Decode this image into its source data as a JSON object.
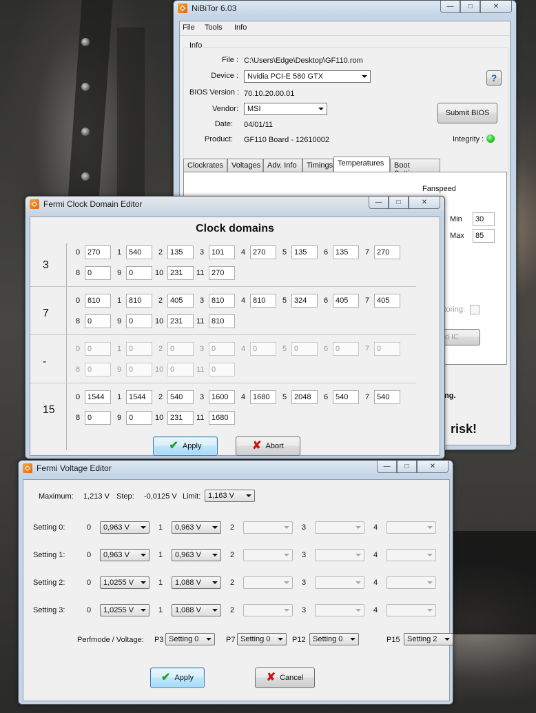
{
  "nibitor": {
    "title": "NiBiTor 6.03",
    "menu": [
      "File",
      "Tools",
      "Info"
    ],
    "info_label": "Info",
    "file_label": "File :",
    "file_value": "C:\\Users\\Edge\\Desktop\\GF110.rom",
    "device_label": "Device :",
    "device_value": "Nvidia PCI-E 580 GTX",
    "bios_label": "BIOS Version :",
    "bios_value": "70.10.20.00.01",
    "vendor_label": "Vendor:",
    "vendor_value": "MSI",
    "date_label": "Date:",
    "date_value": "04/01/11",
    "product_label": "Product:",
    "product_value": "GF110 Board - 12610002",
    "help_label": "?",
    "submit_label": "Submit BIOS",
    "integrity_label": "Integrity :",
    "integrity_color": "#22c022",
    "tabs": [
      "Clockrates",
      "Voltages",
      "Adv. Info",
      "Timings",
      "Temperatures",
      "Boot Settings"
    ],
    "active_tab": "Temperatures",
    "fanspeed_label": "Fanspeed",
    "min_label": "Min",
    "min_value": "30",
    "max_label": "Max",
    "max_value": "85",
    "monitoring_label": "itoring:",
    "partial_button": "d IC",
    "warning_partial": "ing.",
    "risk_partial": "risk!"
  },
  "clock_editor": {
    "title": "Fermi Clock Domain Editor",
    "heading": "Clock domains",
    "domains": [
      {
        "label": "3",
        "enabled": true,
        "row1": [
          [
            "0",
            "270"
          ],
          [
            "1",
            "540"
          ],
          [
            "2",
            "135"
          ],
          [
            "3",
            "101"
          ],
          [
            "4",
            "270"
          ],
          [
            "5",
            "135"
          ],
          [
            "6",
            "135"
          ],
          [
            "7",
            "270"
          ]
        ],
        "row2": [
          [
            "8",
            "0"
          ],
          [
            "9",
            "0"
          ],
          [
            "10",
            "231"
          ],
          [
            "11",
            "270"
          ]
        ]
      },
      {
        "label": "7",
        "enabled": true,
        "row1": [
          [
            "0",
            "810"
          ],
          [
            "1",
            "810"
          ],
          [
            "2",
            "405"
          ],
          [
            "3",
            "810"
          ],
          [
            "4",
            "810"
          ],
          [
            "5",
            "324"
          ],
          [
            "6",
            "405"
          ],
          [
            "7",
            "405"
          ]
        ],
        "row2": [
          [
            "8",
            "0"
          ],
          [
            "9",
            "0"
          ],
          [
            "10",
            "231"
          ],
          [
            "11",
            "810"
          ]
        ]
      },
      {
        "label": "-",
        "enabled": false,
        "row1": [
          [
            "0",
            "0"
          ],
          [
            "1",
            "0"
          ],
          [
            "2",
            "0"
          ],
          [
            "3",
            "0"
          ],
          [
            "4",
            "0"
          ],
          [
            "5",
            "0"
          ],
          [
            "6",
            "0"
          ],
          [
            "7",
            "0"
          ]
        ],
        "row2": [
          [
            "8",
            "0"
          ],
          [
            "9",
            "0"
          ],
          [
            "10",
            "0"
          ],
          [
            "11",
            "0"
          ]
        ]
      },
      {
        "label": "15",
        "enabled": true,
        "row1": [
          [
            "0",
            "1544"
          ],
          [
            "1",
            "1544"
          ],
          [
            "2",
            "540"
          ],
          [
            "3",
            "1600"
          ],
          [
            "4",
            "1680"
          ],
          [
            "5",
            "2048"
          ],
          [
            "6",
            "540"
          ],
          [
            "7",
            "540"
          ]
        ],
        "row2": [
          [
            "8",
            "0"
          ],
          [
            "9",
            "0"
          ],
          [
            "10",
            "231"
          ],
          [
            "11",
            "1680"
          ]
        ]
      }
    ],
    "apply_label": "Apply",
    "abort_label": "Abort"
  },
  "voltage_editor": {
    "title": "Fermi Voltage Editor",
    "maximum_label": "Maximum:",
    "maximum_value": "1,213 V",
    "step_label": "Step:",
    "step_value": "-0,0125 V",
    "limit_label": "Limit:",
    "limit_value": "1,163 V",
    "settings": [
      {
        "label": "Setting 0:",
        "v0": "0,963 V",
        "v1": "0,963 V"
      },
      {
        "label": "Setting 1:",
        "v0": "0,963 V",
        "v1": "0,963 V"
      },
      {
        "label": "Setting 2:",
        "v0": "1,0255 V",
        "v1": "1,088 V"
      },
      {
        "label": "Setting 3:",
        "v0": "1,0255 V",
        "v1": "1,088 V"
      }
    ],
    "col_labels": [
      "0",
      "1",
      "2",
      "3",
      "4"
    ],
    "perfmode_label": "Perfmode / Voltage:",
    "perfmodes": [
      {
        "label": "P3",
        "value": "Setting 0"
      },
      {
        "label": "P7",
        "value": "Setting 0"
      },
      {
        "label": "P12",
        "value": "Setting 0"
      },
      {
        "label": "P15",
        "value": "Setting 2"
      }
    ],
    "apply_label": "Apply",
    "cancel_label": "Cancel"
  }
}
